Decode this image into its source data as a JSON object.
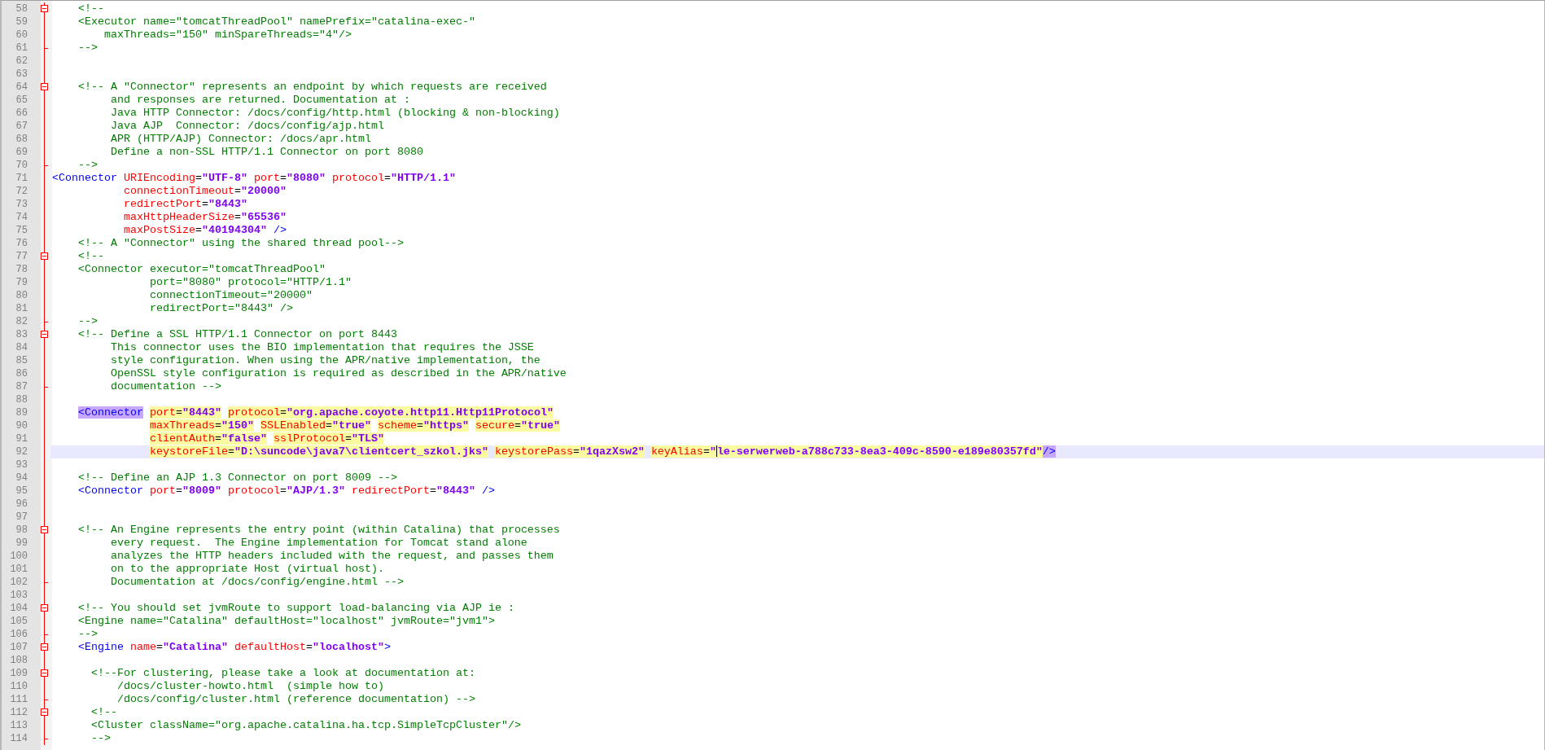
{
  "lines": [
    {
      "number": "58",
      "fold_start": true,
      "current": false,
      "tokens": [
        {
          "kind": "comment",
          "text": "    <!--"
        }
      ]
    },
    {
      "number": "59",
      "current": false,
      "tokens": [
        {
          "kind": "comment",
          "text": "    <Executor name=\"tomcatThreadPool\" namePrefix=\"catalina-exec-\""
        }
      ]
    },
    {
      "number": "60",
      "current": false,
      "tokens": [
        {
          "kind": "comment",
          "text": "        maxThreads=\"150\" minSpareThreads=\"4\"/>"
        }
      ]
    },
    {
      "number": "61",
      "fold_end": true,
      "current": false,
      "tokens": [
        {
          "kind": "comment",
          "text": "    -->"
        }
      ]
    },
    {
      "number": "62",
      "current": false
    },
    {
      "number": "63",
      "current": false
    },
    {
      "number": "64",
      "fold_start": true,
      "current": false,
      "tokens": [
        {
          "kind": "comment",
          "text": "    <!-- A \"Connector\" represents an endpoint by which requests are received"
        }
      ]
    },
    {
      "number": "65",
      "current": false,
      "tokens": [
        {
          "kind": "comment",
          "text": "         and responses are returned. Documentation at :"
        }
      ]
    },
    {
      "number": "66",
      "current": false,
      "tokens": [
        {
          "kind": "comment",
          "text": "         Java HTTP Connector: /docs/config/http.html (blocking & non-blocking)"
        }
      ]
    },
    {
      "number": "67",
      "current": false,
      "tokens": [
        {
          "kind": "comment",
          "text": "         Java AJP  Connector: /docs/config/ajp.html"
        }
      ]
    },
    {
      "number": "68",
      "current": false,
      "tokens": [
        {
          "kind": "comment",
          "text": "         APR (HTTP/AJP) Connector: /docs/apr.html"
        }
      ]
    },
    {
      "number": "69",
      "current": false,
      "tokens": [
        {
          "kind": "comment",
          "text": "         Define a non-SSL HTTP/1.1 Connector on port 8080"
        }
      ]
    },
    {
      "number": "70",
      "fold_end": true,
      "current": false,
      "tokens": [
        {
          "kind": "comment",
          "text": "    -->"
        }
      ]
    },
    {
      "number": "71",
      "current": false,
      "tokens": [
        {
          "kind": "tag",
          "text": "<Connector"
        },
        {
          "kind": "attr",
          "spaced": true,
          "name": "URIEncoding",
          "sep": "=",
          "value": "\"UTF-8\""
        },
        {
          "kind": "attr",
          "spaced": true,
          "name": "port",
          "sep": "=",
          "value": "\"8080\""
        },
        {
          "kind": "attr",
          "spaced": true,
          "name": "protocol",
          "sep": "=",
          "value": "\"HTTP/1.1\""
        }
      ]
    },
    {
      "number": "72",
      "current": false,
      "tokens": [
        {
          "kind": "attr",
          "name": "           connectionTimeout",
          "sep": "=",
          "value": "\"20000\""
        }
      ]
    },
    {
      "number": "73",
      "current": false,
      "tokens": [
        {
          "kind": "attr",
          "name": "           redirectPort",
          "sep": "=",
          "value": "\"8443\""
        }
      ]
    },
    {
      "number": "74",
      "current": false,
      "tokens": [
        {
          "kind": "attr",
          "name": "           maxHttpHeaderSize",
          "sep": "=",
          "value": "\"65536\""
        }
      ]
    },
    {
      "number": "75",
      "current": false,
      "tokens": [
        {
          "kind": "attr",
          "name": "           maxPostSize",
          "sep": "=",
          "value": "\"40194304\""
        },
        {
          "kind": "tag",
          "spaced": true,
          "text": "/>"
        }
      ]
    },
    {
      "number": "76",
      "current": false,
      "tokens": [
        {
          "kind": "comment",
          "text": "    <!-- A \"Connector\" using the shared thread pool-->"
        }
      ]
    },
    {
      "number": "77",
      "fold_start": true,
      "current": false,
      "tokens": [
        {
          "kind": "comment",
          "text": "    <!--"
        }
      ]
    },
    {
      "number": "78",
      "current": false,
      "tokens": [
        {
          "kind": "comment",
          "text": "    <Connector executor=\"tomcatThreadPool\""
        }
      ]
    },
    {
      "number": "79",
      "current": false,
      "tokens": [
        {
          "kind": "comment",
          "text": "               port=\"8080\" protocol=\"HTTP/1.1\""
        }
      ]
    },
    {
      "number": "80",
      "current": false,
      "tokens": [
        {
          "kind": "comment",
          "text": "               connectionTimeout=\"20000\""
        }
      ]
    },
    {
      "number": "81",
      "current": false,
      "tokens": [
        {
          "kind": "comment",
          "text": "               redirectPort=\"8443\" />"
        }
      ]
    },
    {
      "number": "82",
      "fold_end": true,
      "current": false,
      "tokens": [
        {
          "kind": "comment",
          "text": "    -->"
        }
      ]
    },
    {
      "number": "83",
      "fold_start": true,
      "current": false,
      "tokens": [
        {
          "kind": "comment",
          "text": "    <!-- Define a SSL HTTP/1.1 Connector on port 8443"
        }
      ]
    },
    {
      "number": "84",
      "current": false,
      "tokens": [
        {
          "kind": "comment",
          "text": "         This connector uses the BIO implementation that requires the JSSE"
        }
      ]
    },
    {
      "number": "85",
      "current": false,
      "tokens": [
        {
          "kind": "comment",
          "text": "         style configuration. When using the APR/native implementation, the"
        }
      ]
    },
    {
      "number": "86",
      "current": false,
      "tokens": [
        {
          "kind": "comment",
          "text": "         OpenSSL style configuration is required as described in the APR/native"
        }
      ]
    },
    {
      "number": "87",
      "fold_end": true,
      "current": false,
      "tokens": [
        {
          "kind": "comment",
          "text": "         documentation -->"
        }
      ]
    },
    {
      "number": "88",
      "current": false
    },
    {
      "number": "89",
      "current": false,
      "tokens": [
        {
          "kind": "tag",
          "text": "    <Connector",
          "matched": true
        },
        {
          "kind": "attr",
          "spaced": true,
          "name": "port",
          "sep": "=",
          "value": "\"8443\"",
          "highlighted": true
        },
        {
          "kind": "attr",
          "spaced": true,
          "name": "protocol",
          "sep": "=",
          "value": "\"org.apache.coyote.http11.Http11Protocol\"",
          "highlighted": true
        }
      ]
    },
    {
      "number": "90",
      "current": false,
      "tokens": [
        {
          "kind": "attr",
          "name": "               maxThreads",
          "sep": "=",
          "value": "\"150\"",
          "highlighted": true
        },
        {
          "kind": "attr",
          "spaced": true,
          "name": "SSLEnabled",
          "sep": "=",
          "value": "\"true\"",
          "highlighted": true
        },
        {
          "kind": "attr",
          "spaced": true,
          "name": "scheme",
          "sep": "=",
          "value": "\"https\"",
          "highlighted": true
        },
        {
          "kind": "attr",
          "spaced": true,
          "name": "secure",
          "sep": "=",
          "value": "\"true\"",
          "highlighted": true
        }
      ]
    },
    {
      "number": "91",
      "current": false,
      "tokens": [
        {
          "kind": "attr",
          "name": "               clientAuth",
          "sep": "=",
          "value": "\"false\"",
          "highlighted": true
        },
        {
          "kind": "attr",
          "spaced": true,
          "name": "sslProtocol",
          "sep": "=",
          "value": "\"TLS\"",
          "highlighted": true
        }
      ]
    },
    {
      "number": "92",
      "current": true,
      "tokens": [
        {
          "kind": "attr",
          "name": "               keystoreFile",
          "sep": "=",
          "value": "\"D:\\suncode\\java7\\clientcert_szkol.jks\"",
          "highlighted": true
        },
        {
          "kind": "attr",
          "spaced": true,
          "name": "keystorePass",
          "sep": "=",
          "value": "\"1qazXsw2\"",
          "highlighted": true
        },
        {
          "kind": "attr",
          "spaced": true,
          "name": "keyAlias",
          "sep": "=",
          "value": "\"le-serwerweb-a788c733-8ea3-409c-8590-e189e80357fd\"",
          "highlighted": true,
          "caret": true
        },
        {
          "kind": "tag",
          "text": "/>",
          "matched": true
        }
      ]
    },
    {
      "number": "93",
      "current": false
    },
    {
      "number": "94",
      "current": false,
      "tokens": [
        {
          "kind": "comment",
          "text": "    <!-- Define an AJP 1.3 Connector on port 8009 -->"
        }
      ]
    },
    {
      "number": "95",
      "current": false,
      "tokens": [
        {
          "kind": "tag",
          "text": "    <Connector"
        },
        {
          "kind": "attr",
          "spaced": true,
          "name": "port",
          "sep": "=",
          "value": "\"8009\""
        },
        {
          "kind": "attr",
          "spaced": true,
          "name": "protocol",
          "sep": "=",
          "value": "\"AJP/1.3\""
        },
        {
          "kind": "attr",
          "spaced": true,
          "name": "redirectPort",
          "sep": "=",
          "value": "\"8443\""
        },
        {
          "kind": "tag",
          "spaced": true,
          "text": "/>"
        }
      ]
    },
    {
      "number": "96",
      "current": false
    },
    {
      "number": "97",
      "current": false
    },
    {
      "number": "98",
      "fold_start": true,
      "current": false,
      "tokens": [
        {
          "kind": "comment",
          "text": "    <!-- An Engine represents the entry point (within Catalina) that processes"
        }
      ]
    },
    {
      "number": "99",
      "current": false,
      "tokens": [
        {
          "kind": "comment",
          "text": "         every request.  The Engine implementation for Tomcat stand alone"
        }
      ]
    },
    {
      "number": "100",
      "current": false,
      "tokens": [
        {
          "kind": "comment",
          "text": "         analyzes the HTTP headers included with the request, and passes them"
        }
      ]
    },
    {
      "number": "101",
      "current": false,
      "tokens": [
        {
          "kind": "comment",
          "text": "         on to the appropriate Host (virtual host)."
        }
      ]
    },
    {
      "number": "102",
      "fold_end": true,
      "current": false,
      "tokens": [
        {
          "kind": "comment",
          "text": "         Documentation at /docs/config/engine.html -->"
        }
      ]
    },
    {
      "number": "103",
      "current": false
    },
    {
      "number": "104",
      "fold_start": true,
      "current": false,
      "tokens": [
        {
          "kind": "comment",
          "text": "    <!-- You should set jvmRoute to support load-balancing via AJP ie :"
        }
      ]
    },
    {
      "number": "105",
      "current": false,
      "tokens": [
        {
          "kind": "comment",
          "text": "    <Engine name=\"Catalina\" defaultHost=\"localhost\" jvmRoute=\"jvm1\">"
        }
      ]
    },
    {
      "number": "106",
      "fold_end": true,
      "current": false,
      "tokens": [
        {
          "kind": "comment",
          "text": "    -->"
        }
      ]
    },
    {
      "number": "107",
      "fold_start": true,
      "current": false,
      "tokens": [
        {
          "kind": "tag",
          "text": "    <Engine"
        },
        {
          "kind": "attr",
          "spaced": true,
          "name": "name",
          "sep": "=",
          "value": "\"Catalina\""
        },
        {
          "kind": "attr",
          "spaced": true,
          "name": "defaultHost",
          "sep": "=",
          "value": "\"localhost\""
        },
        {
          "kind": "tag",
          "text": ">"
        }
      ]
    },
    {
      "number": "108",
      "current": false
    },
    {
      "number": "109",
      "fold_start": true,
      "current": false,
      "tokens": [
        {
          "kind": "comment",
          "text": "      <!--For clustering, please take a look at documentation at:"
        }
      ]
    },
    {
      "number": "110",
      "current": false,
      "tokens": [
        {
          "kind": "comment",
          "text": "          /docs/cluster-howto.html  (simple how to)"
        }
      ]
    },
    {
      "number": "111",
      "fold_end": true,
      "current": false,
      "tokens": [
        {
          "kind": "comment",
          "text": "          /docs/config/cluster.html (reference documentation) -->"
        }
      ]
    },
    {
      "number": "112",
      "fold_start": true,
      "current": false,
      "tokens": [
        {
          "kind": "comment",
          "text": "      <!--"
        }
      ]
    },
    {
      "number": "113",
      "current": false,
      "tokens": [
        {
          "kind": "comment",
          "text": "      <Cluster className=\"org.apache.catalina.ha.tcp.SimpleTcpCluster\"/>"
        }
      ]
    },
    {
      "number": "114",
      "fold_end": true,
      "current": false,
      "tokens": [
        {
          "kind": "comment",
          "text": "      -->"
        }
      ]
    }
  ]
}
